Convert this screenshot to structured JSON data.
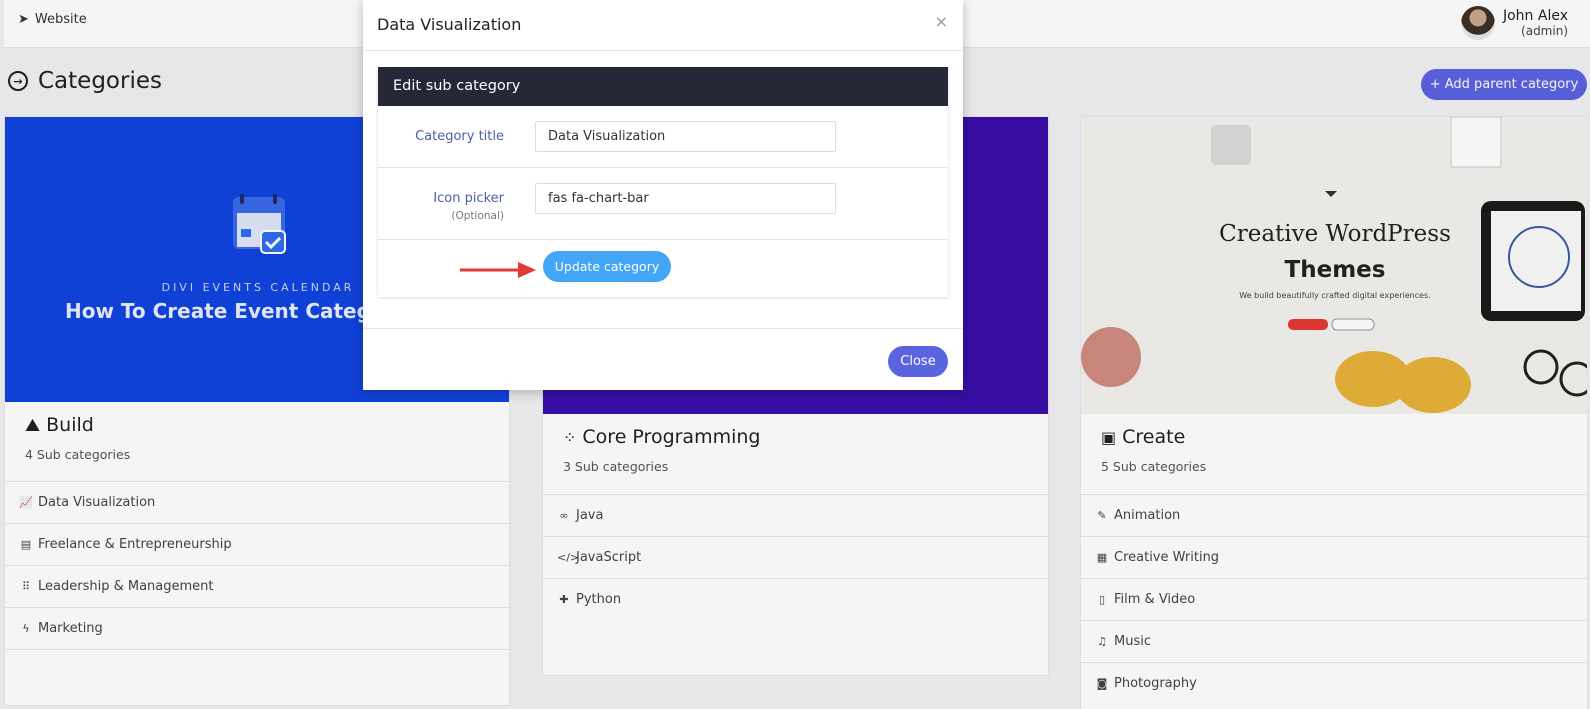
{
  "topbar": {
    "site_label": "Website",
    "user_name": "John Alex",
    "user_role": "(admin)"
  },
  "page": {
    "title": "Categories",
    "add_parent_label": "+ Add parent category"
  },
  "cards": [
    {
      "banner_top": "DIVI EVENTS CALENDAR",
      "banner_headline": "How To Create Event Categor",
      "title": "Build",
      "subtitle": "4 Sub categories",
      "items": [
        {
          "icon": "chart-line-icon",
          "label": "Data Visualization"
        },
        {
          "icon": "newspaper-icon",
          "label": "Freelance & Entrepreneurship"
        },
        {
          "icon": "grip-icon",
          "label": "Leadership & Management"
        },
        {
          "icon": "bolt-icon",
          "label": "Marketing"
        }
      ]
    },
    {
      "title": "Core Programming",
      "subtitle": "3 Sub categories",
      "items": [
        {
          "icon": "mask-icon",
          "label": "Java"
        },
        {
          "icon": "code-icon",
          "label": "JavaScript"
        },
        {
          "icon": "puzzle-icon",
          "label": "Python"
        }
      ]
    },
    {
      "banner_line1": "Creative WordPress",
      "banner_line2": "Themes",
      "banner_tag": "We build beautifully crafted digital experiences.",
      "title": "Create",
      "subtitle": "5 Sub categories",
      "items": [
        {
          "icon": "medal-icon",
          "label": "Animation"
        },
        {
          "icon": "calendar-icon",
          "label": "Creative Writing"
        },
        {
          "icon": "file-icon",
          "label": "Film & Video"
        },
        {
          "icon": "music-icon",
          "label": "Music"
        },
        {
          "icon": "camera-icon",
          "label": "Photography"
        }
      ]
    }
  ],
  "modal": {
    "title": "Data Visualization",
    "close_x": "×",
    "panel_title": "Edit sub category",
    "fields": {
      "category_title_label": "Category title",
      "category_title_value": "Data Visualization",
      "icon_picker_label": "Icon picker",
      "icon_picker_optional": "(Optional)",
      "icon_picker_value": "fas fa-chart-bar"
    },
    "update_label": "Update category",
    "close_label": "Close"
  },
  "colors": {
    "accent": "#5a63e0",
    "update": "#42a5f5",
    "panel_header": "#262838",
    "arrow": "#e53935"
  }
}
